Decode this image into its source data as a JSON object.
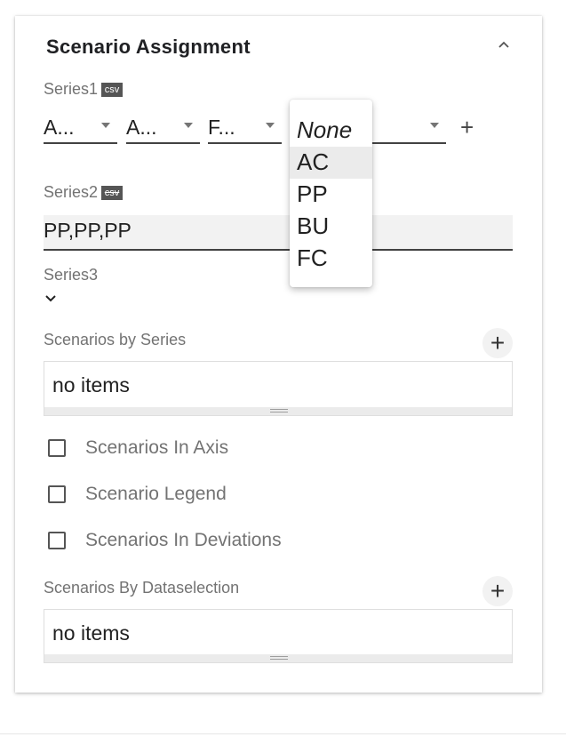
{
  "panel": {
    "title": "Scenario Assignment",
    "collapse_icon": "chevron-up-icon"
  },
  "series1": {
    "label": "Series1",
    "badge": "csv",
    "dropdowns": [
      "A...",
      "A...",
      "F...",
      "None"
    ],
    "add_icon": "plus-icon"
  },
  "series2": {
    "label": "Series2",
    "badge": "csv",
    "value": "PP,PP,PP"
  },
  "series3": {
    "label": "Series3",
    "expand_icon": "chevron-down-icon"
  },
  "scenarios_by_series": {
    "label": "Scenarios by Series",
    "empty_text": "no items",
    "add_icon": "plus-icon"
  },
  "checkboxes": [
    {
      "label": "Scenarios In Axis",
      "checked": false
    },
    {
      "label": "Scenario Legend",
      "checked": false
    },
    {
      "label": "Scenarios In Deviations",
      "checked": false
    }
  ],
  "scenarios_by_dataselection": {
    "label": "Scenarios By Dataselection",
    "empty_text": "no items",
    "add_icon": "plus-icon"
  },
  "dropdown_menu": {
    "options": [
      "None",
      "AC",
      "PP",
      "BU",
      "FC"
    ],
    "highlighted": "AC"
  },
  "colors": {
    "accent_dark": "#424242",
    "label_gray": "#737373",
    "field_bg": "#f2f2f2"
  }
}
